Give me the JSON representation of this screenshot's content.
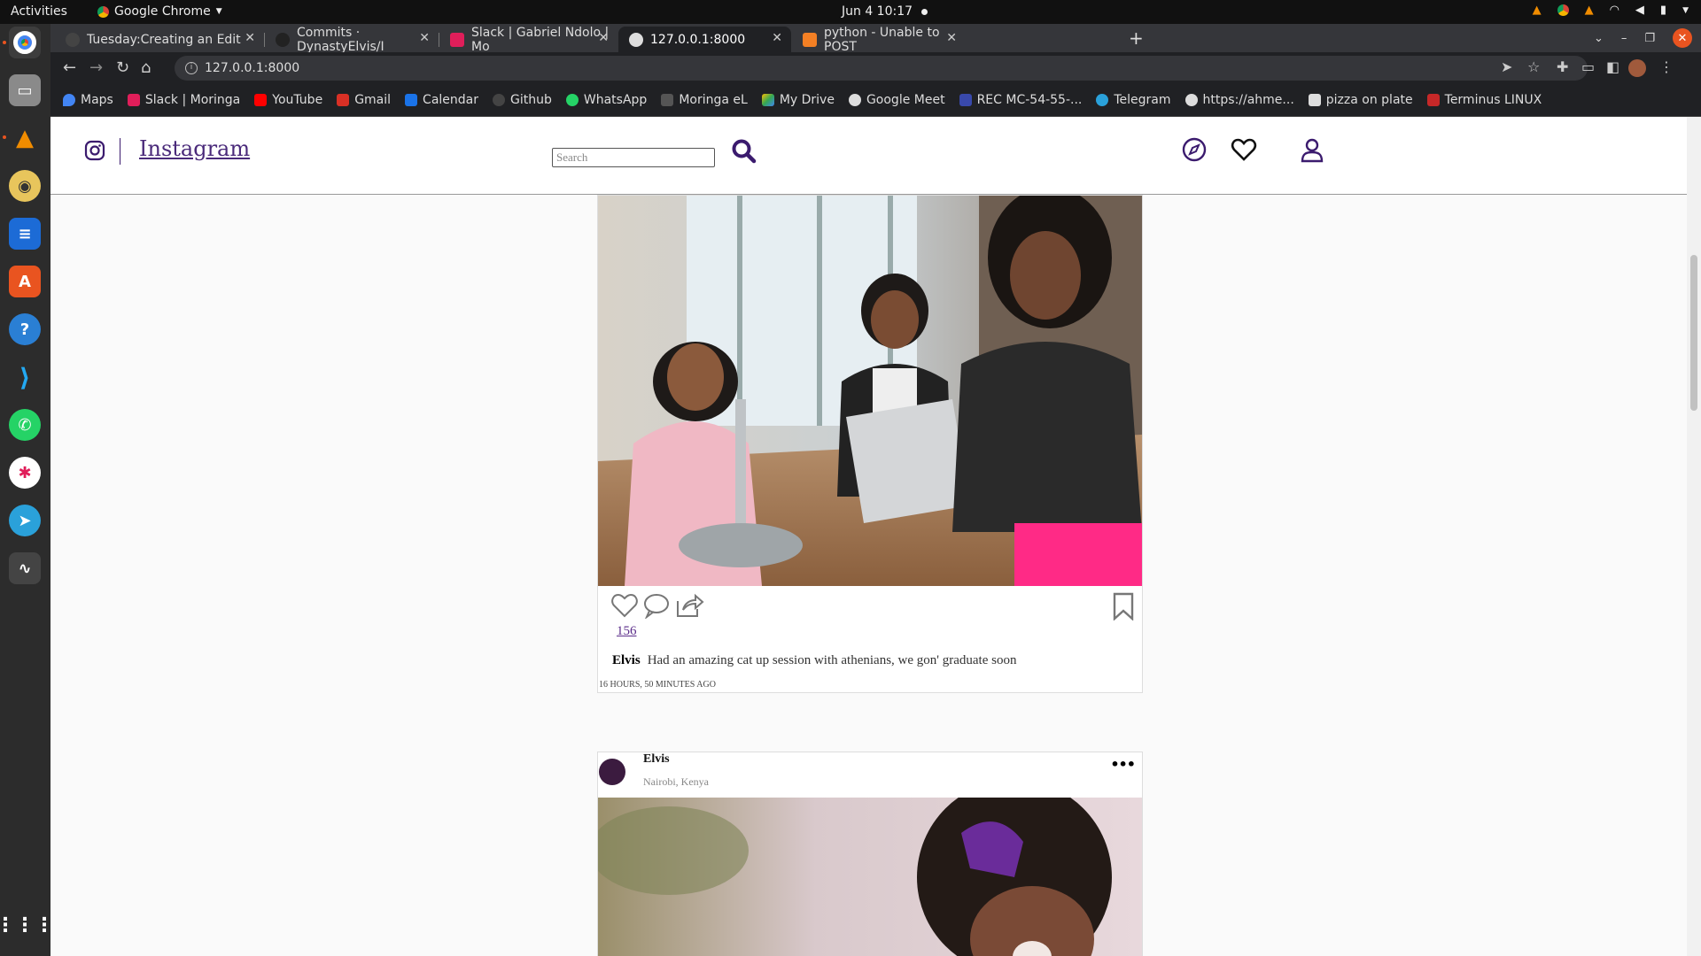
{
  "system": {
    "activities": "Activities",
    "app_name": "Google Chrome",
    "clock": "Jun 4  10:17"
  },
  "browser": {
    "tabs": [
      {
        "title": "Tuesday:Creating an Edit"
      },
      {
        "title": "Commits · DynastyElvis/I"
      },
      {
        "title": "Slack | Gabriel Ndolo | Mo"
      },
      {
        "title": "127.0.0.1:8000"
      },
      {
        "title": "python - Unable to POST"
      }
    ],
    "url": "127.0.0.1:8000",
    "bookmarks": [
      {
        "label": "Maps",
        "color": "#4285f4"
      },
      {
        "label": "Slack | Moringa",
        "color": "#e01e5a"
      },
      {
        "label": "YouTube",
        "color": "#ff0000"
      },
      {
        "label": "Gmail",
        "color": "#d93025"
      },
      {
        "label": "Calendar",
        "color": "#1a73e8"
      },
      {
        "label": "Github",
        "color": "#444444"
      },
      {
        "label": "WhatsApp",
        "color": "#25d366"
      },
      {
        "label": "Moringa eL",
        "color": "#555555"
      },
      {
        "label": "My Drive",
        "color": "#fbbc04"
      },
      {
        "label": "Google Meet",
        "color": "#dddddd"
      },
      {
        "label": "REC MC-54-55-...",
        "color": "#3949ab"
      },
      {
        "label": "Telegram",
        "color": "#2aa1da"
      },
      {
        "label": "https://ahme...",
        "color": "#dddddd"
      },
      {
        "label": "pizza on plate",
        "color": "#dddddd"
      },
      {
        "label": "Terminus LINUX",
        "color": "#c62828"
      }
    ]
  },
  "app": {
    "brand": "Instagram",
    "search_placeholder": "Search",
    "accent": "#3b1b6e"
  },
  "posts": [
    {
      "likes": "156",
      "user": "Elvis",
      "caption": "Had an amazing cat up session with athenians, we gon' graduate soon",
      "time": "16 HOURS, 50 MINUTES AGO"
    },
    {
      "user": "Elvis",
      "location": "Nairobi, Kenya",
      "more": "•••"
    }
  ]
}
